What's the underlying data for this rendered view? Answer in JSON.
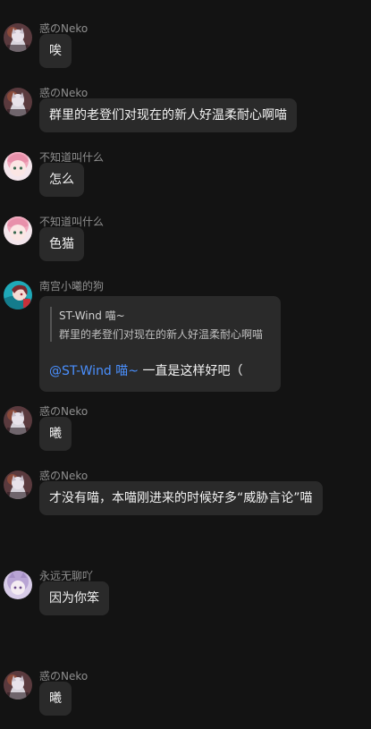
{
  "messages": [
    {
      "sender": "惑のNeko",
      "avatar": "neko",
      "text": "唉"
    },
    {
      "sender": "惑のNeko",
      "avatar": "neko",
      "text": "群里的老登们对现在的新人好温柔耐心啊喵"
    },
    {
      "sender": "不知道叫什么",
      "avatar": "pink",
      "text": "怎么"
    },
    {
      "sender": "不知道叫什么",
      "avatar": "pink",
      "text": "色猫"
    },
    {
      "sender": "南宫小曦的狗",
      "avatar": "teal",
      "quote_author": "ST-Wind 喵~",
      "quote_text": "群里的老登们对现在的新人好温柔耐心啊喵",
      "mention": "@ST-Wind 喵~",
      "text": "一直是这样好吧（"
    },
    {
      "sender": "惑のNeko",
      "avatar": "neko",
      "text": "曦"
    },
    {
      "sender": "惑のNeko",
      "avatar": "neko",
      "text": "才没有喵，本喵刚进来的时候好多“威胁言论”喵"
    },
    {
      "sender": "永远无聊吖",
      "avatar": "lilac",
      "text": "因为你笨"
    },
    {
      "sender": "惑のNeko",
      "avatar": "neko",
      "text": "曦"
    }
  ],
  "colors": {
    "background": "#131313",
    "bubble": "#2a2a2a",
    "mention": "#4a90ff"
  }
}
